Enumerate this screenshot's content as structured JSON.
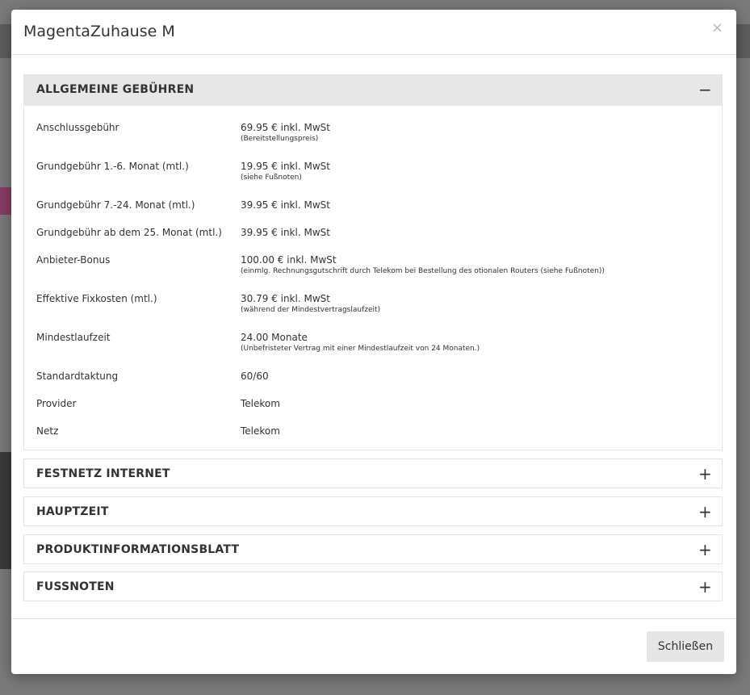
{
  "modal": {
    "title": "MagentaZuhause M",
    "close_icon": "×",
    "close_button_label": "Schließen"
  },
  "sections": [
    {
      "title": "ALLGEMEINE GEBÜHREN",
      "expanded": true,
      "toggle": "−",
      "rows": [
        {
          "label": "Anschlussgebühr",
          "value": "69.95 € inkl. MwSt",
          "note": "(Bereitstellungspreis)"
        },
        {
          "label": "Grundgebühr 1.-6. Monat (mtl.)",
          "value": "19.95 € inkl. MwSt",
          "note": "(siehe Fußnoten)"
        },
        {
          "label": "Grundgebühr 7.-24. Monat (mtl.)",
          "value": "39.95 € inkl. MwSt",
          "note": ""
        },
        {
          "label": "Grundgebühr ab dem 25. Monat (mtl.)",
          "value": "39.95 € inkl. MwSt",
          "note": ""
        },
        {
          "label": "Anbieter-Bonus",
          "value": "100.00 € inkl. MwSt",
          "note": "(einmlg. Rechnungsgutschrift durch Telekom bei Bestellung des otionalen Routers (siehe Fußnoten))"
        },
        {
          "label": "Effektive Fixkosten (mtl.)",
          "value": "30.79 € inkl. MwSt",
          "note": "(während der Mindestvertragslaufzeit)"
        },
        {
          "label": "Mindestlaufzeit",
          "value": "24.00 Monate",
          "note": "(Unbefristeter Vertrag mit einer Mindestlaufzeit von 24 Monaten.)"
        },
        {
          "label": "Standardtaktung",
          "value": "60/60",
          "note": ""
        },
        {
          "label": "Provider",
          "value": "Telekom",
          "note": ""
        },
        {
          "label": "Netz",
          "value": "Telekom",
          "note": ""
        }
      ]
    },
    {
      "title": "FESTNETZ INTERNET",
      "expanded": false,
      "toggle": "+"
    },
    {
      "title": "HAUPTZEIT",
      "expanded": false,
      "toggle": "+"
    },
    {
      "title": "PRODUKTINFORMATIONSBLATT",
      "expanded": false,
      "toggle": "+"
    },
    {
      "title": "FUSSNOTEN",
      "expanded": false,
      "toggle": "+"
    }
  ]
}
